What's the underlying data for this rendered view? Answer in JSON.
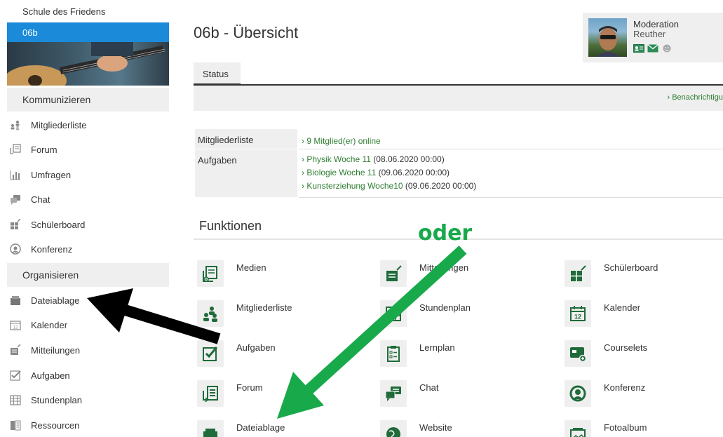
{
  "sidebar": {
    "school": "Schule des Friedens",
    "group": "06b",
    "sections": [
      "Kommunizieren",
      "Organisieren"
    ],
    "kommunizieren": [
      {
        "label": "Mitgliederliste",
        "icon": "members-icon"
      },
      {
        "label": "Forum",
        "icon": "forum-icon"
      },
      {
        "label": "Umfragen",
        "icon": "poll-icon"
      },
      {
        "label": "Chat",
        "icon": "chat-icon"
      },
      {
        "label": "Schülerboard",
        "icon": "board-icon"
      },
      {
        "label": "Konferenz",
        "icon": "conference-icon"
      }
    ],
    "organisieren": [
      {
        "label": "Dateiablage",
        "icon": "folder-icon"
      },
      {
        "label": "Kalender",
        "icon": "calendar-icon"
      },
      {
        "label": "Mitteilungen",
        "icon": "messages-icon"
      },
      {
        "label": "Aufgaben",
        "icon": "tasks-icon"
      },
      {
        "label": "Stundenplan",
        "icon": "timetable-icon"
      },
      {
        "label": "Ressourcen",
        "icon": "resources-icon"
      }
    ]
  },
  "main": {
    "title": "06b - Übersicht",
    "tab": "Status",
    "notification_link": "› Benachrichtigu",
    "info": {
      "members_label": "Mitgliederliste",
      "members_value": "9 Mitglied(er) online",
      "tasks_label": "Aufgaben",
      "tasks": [
        {
          "name": "Physik Woche 11",
          "date": "(08.06.2020 00:00)"
        },
        {
          "name": "Biologie Woche 11",
          "date": "(09.06.2020 00:00)"
        },
        {
          "name": "Kunsterziehung Woche10",
          "date": "(09.06.2020 00:00)"
        }
      ]
    },
    "functions_title": "Funktionen",
    "functions": [
      [
        "Medien",
        "Mitteilungen",
        "Schülerboard"
      ],
      [
        "Mitgliederliste",
        "Stundenplan",
        "Kalender"
      ],
      [
        "Aufgaben",
        "Lernplan",
        "Courselets"
      ],
      [
        "Forum",
        "Chat",
        "Konferenz"
      ],
      [
        "Dateiablage",
        "Website",
        "Fotoalbum"
      ]
    ]
  },
  "moderator": {
    "role": "Moderation",
    "name": "Reuther"
  },
  "annotation": {
    "text": "oder",
    "arrow_colors": {
      "black": "#000000",
      "green": "#18a94b"
    }
  },
  "colors": {
    "accent": "#1a8ad9",
    "link": "#2e7d32",
    "icon": "#1f6b3a"
  }
}
